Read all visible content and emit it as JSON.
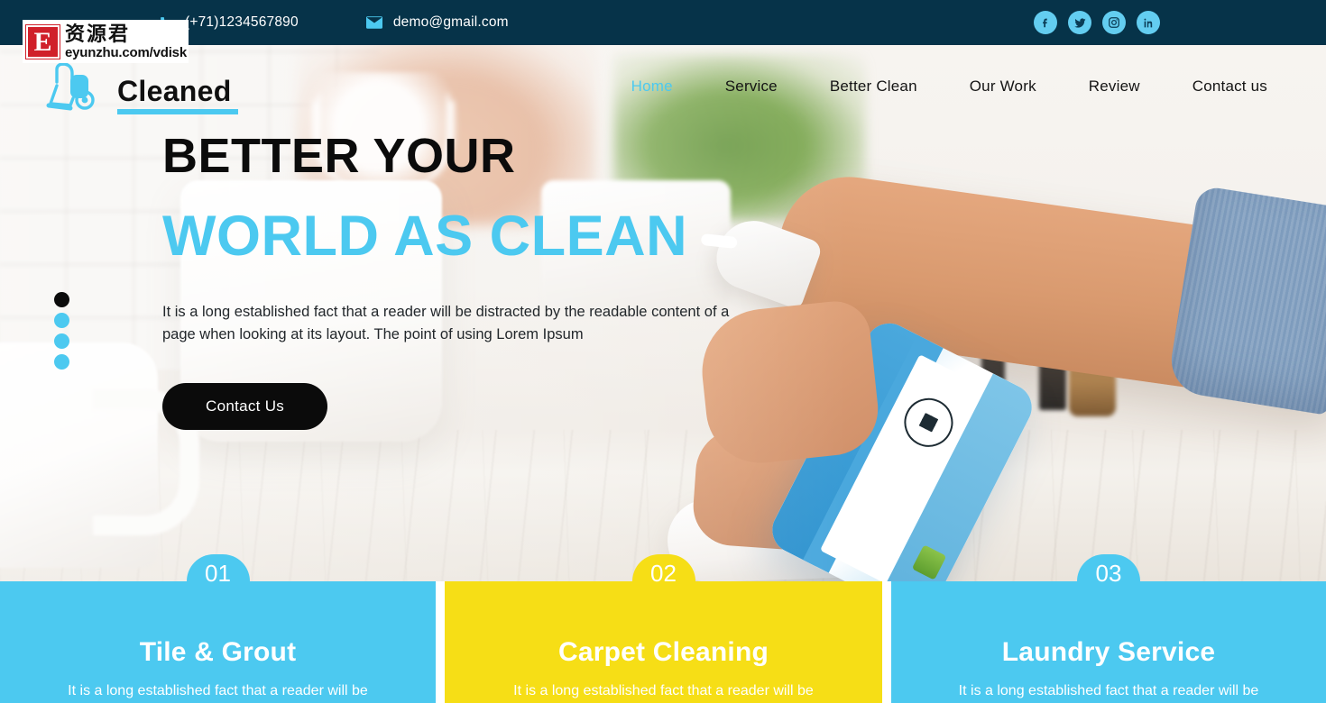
{
  "topbar": {
    "phone": "(+71)1234567890",
    "email": "demo@gmail.com",
    "phone_icon": "phone-icon",
    "email_icon": "envelope-icon",
    "social": [
      {
        "name": "facebook-icon",
        "label": "f"
      },
      {
        "name": "twitter-icon",
        "label": "t"
      },
      {
        "name": "instagram-icon",
        "label": "ig"
      },
      {
        "name": "linkedin-icon",
        "label": "in"
      }
    ],
    "bg_color": "#063349",
    "accent_color": "#4cc9f0"
  },
  "watermark": {
    "badge_letter": "E",
    "title_cn": "资源君",
    "url": "eyunzhu.com/vdisk",
    "badge_color": "#d0202a"
  },
  "brand": {
    "name": "Cleaned",
    "logo_icon": "vacuum-cleaner-icon",
    "accent_color": "#4cc9f0"
  },
  "nav": {
    "items": [
      {
        "label": "Home",
        "active": true
      },
      {
        "label": "Service",
        "active": false
      },
      {
        "label": "Better Clean",
        "active": false
      },
      {
        "label": "Our Work",
        "active": false
      },
      {
        "label": "Review",
        "active": false
      },
      {
        "label": "Contact us",
        "active": false
      }
    ]
  },
  "hero": {
    "title_line1": "BETTER YOUR",
    "title_line2": "WORLD AS CLEAN",
    "paragraph": "It is a long established fact that a reader will be distracted by the readable content of a page when looking at its layout. The point of using Lorem Ipsum",
    "cta_label": "Contact Us",
    "title1_color": "#0b0b0b",
    "title2_color": "#4cc9f0",
    "cta_bg": "#0b0b0b",
    "slider": {
      "total": 4,
      "active_index": 0,
      "active_color": "#0b0b0b",
      "inactive_color": "#4cc9f0"
    }
  },
  "services": [
    {
      "number": "01",
      "title": "Tile & Grout",
      "description": "It is a long established fact that a reader will be",
      "color": "#4cc9f0"
    },
    {
      "number": "02",
      "title": "Carpet Cleaning",
      "description": "It is a long established fact that a reader will be",
      "color": "#f6de16"
    },
    {
      "number": "03",
      "title": "Laundry Service",
      "description": "It is a long established fact that a reader will be",
      "color": "#4cc9f0"
    }
  ]
}
